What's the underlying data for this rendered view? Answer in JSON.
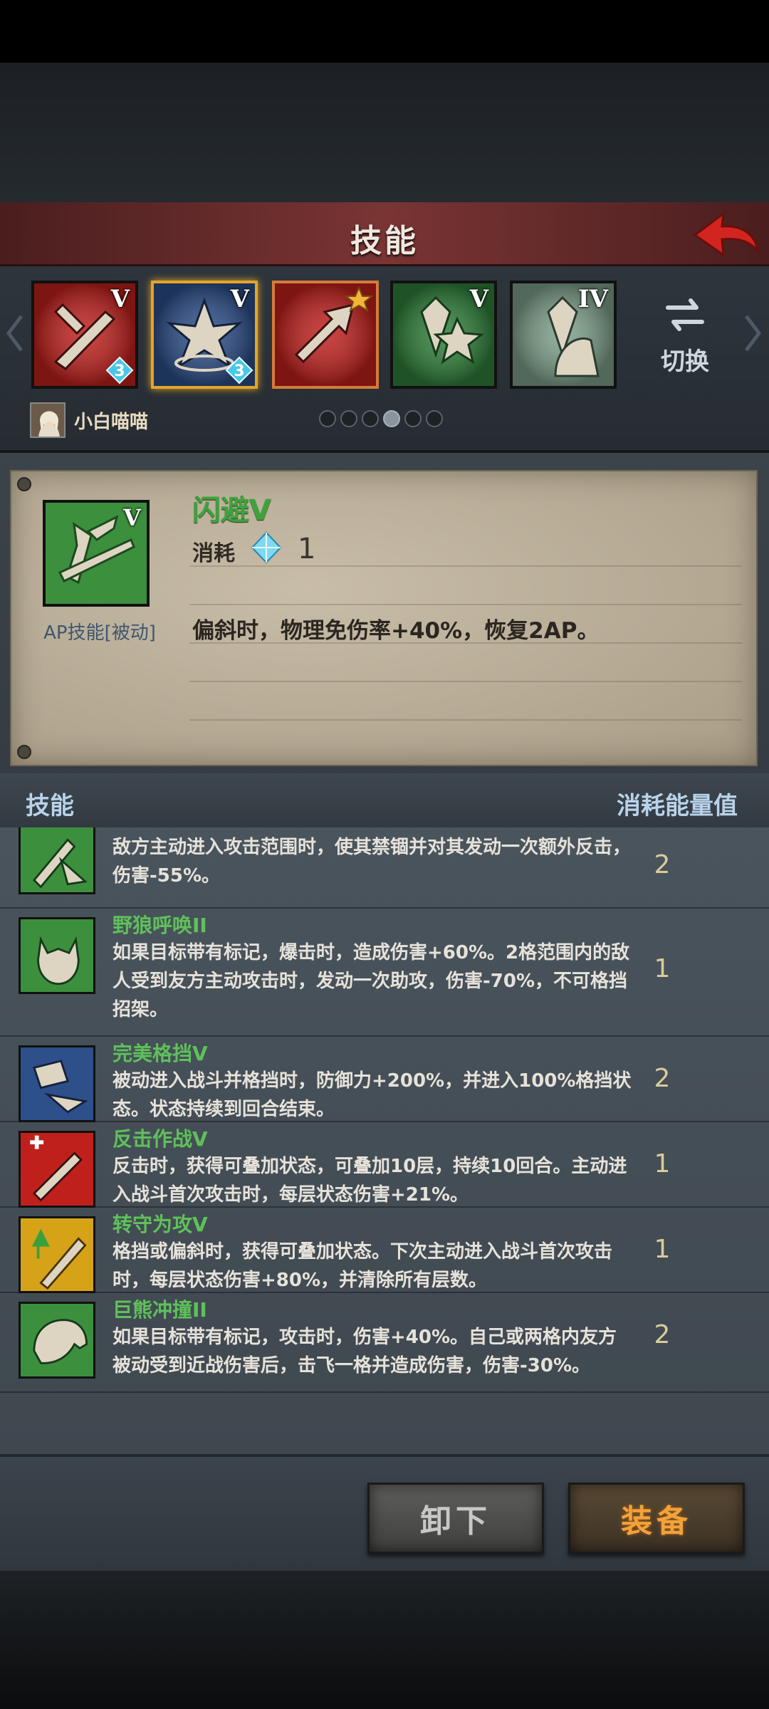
{
  "header": {
    "title": "技能"
  },
  "strip": {
    "slots": [
      {
        "tier": "V",
        "gem": "3",
        "color": "#c0201c",
        "state": "normal"
      },
      {
        "tier": "V",
        "gem": "3",
        "color": "#2d4f8a",
        "state": "selected"
      },
      {
        "tier": "",
        "gem": "",
        "color": "#c0201c",
        "state": "starred"
      },
      {
        "tier": "V",
        "gem": "",
        "color": "#2f7f3a",
        "state": "normal"
      },
      {
        "tier": "IV",
        "gem": "",
        "color": "#7ea08a",
        "state": "normal"
      }
    ],
    "switch_label": "切换",
    "player_name": "小白喵喵",
    "pages": 6,
    "active_page": 4
  },
  "detail": {
    "name": "闪避V",
    "tier": "V",
    "cost_label": "消耗",
    "cost": "1",
    "type": "AP技能[被动]",
    "desc": "偏斜时，物理免伤率+40%，恢复2AP。"
  },
  "list_header": {
    "left": "技能",
    "right": "消耗能量值"
  },
  "skills": [
    {
      "name": "",
      "color": "#3c8f3d",
      "desc": "敌方主动进入攻击范围时，使其禁锢并对其发动一次额外反击，伤害-55%。",
      "cost": "2"
    },
    {
      "name": "野狼呼唤II",
      "color": "#3c8f3d",
      "desc": "如果目标带有标记，爆击时，造成伤害+60%。2格范围内的敌人受到友方主动攻击时，发动一次助攻，伤害-70%，不可格挡招架。",
      "cost": "1"
    },
    {
      "name": "完美格挡V",
      "color": "#2d4f8a",
      "desc": "被动进入战斗并格挡时，防御力+200%，并进入100%格挡状态。状态持续到回合结束。",
      "cost": "2"
    },
    {
      "name": "反击作战V",
      "color": "#c0201c",
      "desc": "反击时，获得可叠加状态，可叠加10层，持续10回合。主动进入战斗首次攻击时，每层状态伤害+21%。",
      "cost": "1"
    },
    {
      "name": "转守为攻V",
      "color": "#d6a318",
      "desc": "格挡或偏斜时，获得可叠加状态。下次主动进入战斗首次攻击时，每层状态伤害+80%，并清除所有层数。",
      "cost": "1"
    },
    {
      "name": "巨熊冲撞II",
      "color": "#3c8f3d",
      "desc": "如果目标带有标记，攻击时，伤害+40%。自己或两格内友方被动受到近战伤害后，击飞一格并造成伤害，伤害-30%。",
      "cost": "2"
    }
  ],
  "buttons": {
    "unequip": "卸下",
    "equip": "装备"
  }
}
